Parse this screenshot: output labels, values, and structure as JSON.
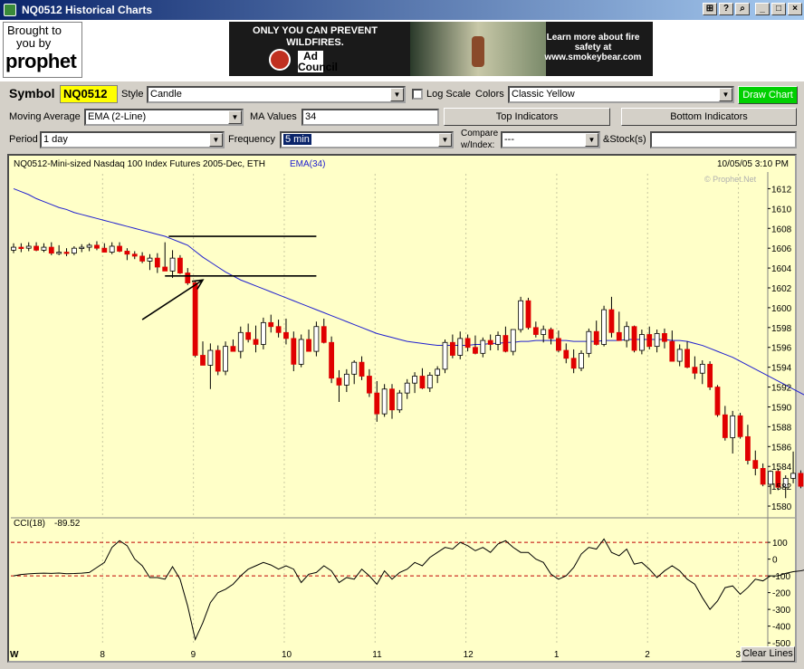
{
  "window": {
    "title": "NQ0512 Historical Charts",
    "controls": [
      "ok-icon",
      "help-icon",
      "search-icon",
      "minimize-icon",
      "maximize-icon",
      "close-icon"
    ]
  },
  "branding": {
    "brought_line1": "Brought to",
    "brought_line2": "you by",
    "logo_text": "prophet"
  },
  "ad": {
    "left_text": "ONLY YOU CAN PREVENT WILDFIRES.",
    "right_text": "Learn more about fire safety at www.smokeybear.com",
    "council": "Ad Council"
  },
  "toolbar": {
    "symbol_label": "Symbol",
    "symbol_value": "NQ0512",
    "style_label": "Style",
    "style_value": "Candle",
    "log_scale_label": "Log Scale",
    "colors_label": "Colors",
    "colors_value": "Classic Yellow",
    "draw_chart": "Draw Chart",
    "ma_label": "Moving Average",
    "ma_value": "EMA (2-Line)",
    "ma_values_label": "MA Values",
    "ma_values_value": "34",
    "top_indicators": "Top Indicators",
    "bottom_indicators": "Bottom Indicators",
    "period_label": "Period",
    "period_value": "1 day",
    "frequency_label": "Frequency",
    "frequency_value": "5 min",
    "compare_label_1": "Compare",
    "compare_label_2": "w/Index:",
    "compare_value": "---",
    "stocks_label": "&Stock(s)",
    "stocks_value": ""
  },
  "chart": {
    "heading": "NQ0512-Mini-sized Nasdaq 100 Index Futures 2005-Dec, ETH",
    "ema_label": "EMA(34)",
    "timestamp": "10/05/05  3:10 PM",
    "watermark": "© Prophet.Net",
    "clear_lines": "Clear Lines",
    "cci_label": "CCI(18)",
    "cci_value": "-89.52",
    "x_ticks": [
      "W",
      "8",
      "9",
      "10",
      "11",
      "12",
      "1",
      "2",
      "3"
    ],
    "colors": {
      "up": "#ffffff",
      "down": "#e00000",
      "ema": "#2020d0",
      "cci_ref": "#c00000",
      "bg": "#ffffc8"
    }
  },
  "chart_data": [
    {
      "type": "candlestick",
      "title": "NQ0512-Mini-sized Nasdaq 100 Index Futures 2005-Dec, ETH",
      "ylim": [
        1579,
        1613.5
      ],
      "y_ticks": [
        1580,
        1582,
        1584,
        1586,
        1588,
        1590,
        1592,
        1594,
        1596,
        1598,
        1600,
        1602,
        1604,
        1606,
        1608,
        1610,
        1612
      ],
      "x_tick_labels": [
        "W",
        "8",
        "9",
        "10",
        "11",
        "12",
        "1",
        "2",
        "3"
      ],
      "x_tick_bars": [
        0,
        12,
        24,
        36,
        48,
        60,
        72,
        84,
        96
      ],
      "candles": [
        [
          1605.8,
          1606.5,
          1605.5,
          1606.1
        ],
        [
          1606.1,
          1606.5,
          1605.6,
          1606.0
        ],
        [
          1606.0,
          1606.6,
          1605.7,
          1606.2
        ],
        [
          1606.2,
          1606.6,
          1605.7,
          1605.8
        ],
        [
          1605.8,
          1606.5,
          1605.6,
          1606.1
        ],
        [
          1606.1,
          1606.6,
          1605.3,
          1605.5
        ],
        [
          1605.5,
          1606.3,
          1605.3,
          1605.6
        ],
        [
          1605.6,
          1606.0,
          1605.2,
          1605.5
        ],
        [
          1605.5,
          1606.2,
          1605.3,
          1606.0
        ],
        [
          1606.0,
          1606.4,
          1605.6,
          1606.1
        ],
        [
          1606.1,
          1606.5,
          1605.7,
          1606.3
        ],
        [
          1606.3,
          1606.7,
          1605.8,
          1606.0
        ],
        [
          1606.0,
          1606.5,
          1605.6,
          1605.6
        ],
        [
          1605.6,
          1606.6,
          1605.4,
          1606.2
        ],
        [
          1606.2,
          1606.6,
          1605.6,
          1605.7
        ],
        [
          1605.7,
          1606.0,
          1604.8,
          1605.4
        ],
        [
          1605.4,
          1605.7,
          1604.9,
          1605.2
        ],
        [
          1605.2,
          1605.6,
          1604.5,
          1604.7
        ],
        [
          1604.7,
          1605.4,
          1603.8,
          1605.0
        ],
        [
          1605.0,
          1605.5,
          1603.5,
          1604.1
        ],
        [
          1604.1,
          1606.6,
          1603.8,
          1603.7
        ],
        [
          1603.7,
          1605.8,
          1603.0,
          1605.0
        ],
        [
          1605.0,
          1605.3,
          1603.4,
          1603.5
        ],
        [
          1603.5,
          1604.0,
          1602.3,
          1602.5
        ],
        [
          1602.5,
          1602.7,
          1595.0,
          1595.2
        ],
        [
          1595.2,
          1596.6,
          1594.2,
          1594.2
        ],
        [
          1594.2,
          1596.4,
          1591.8,
          1595.7
        ],
        [
          1595.7,
          1596.2,
          1593.2,
          1593.6
        ],
        [
          1593.6,
          1596.6,
          1593.2,
          1596.1
        ],
        [
          1596.1,
          1596.8,
          1595.6,
          1595.6
        ],
        [
          1595.6,
          1598.1,
          1594.9,
          1597.5
        ],
        [
          1597.5,
          1598.4,
          1596.5,
          1596.8
        ],
        [
          1596.8,
          1598.2,
          1595.5,
          1596.3
        ],
        [
          1596.3,
          1599.0,
          1595.8,
          1598.5
        ],
        [
          1598.5,
          1599.3,
          1597.5,
          1598.1
        ],
        [
          1598.1,
          1598.8,
          1597.0,
          1597.5
        ],
        [
          1597.5,
          1598.9,
          1596.3,
          1596.9
        ],
        [
          1596.9,
          1597.6,
          1593.6,
          1594.3
        ],
        [
          1594.3,
          1597.3,
          1594.0,
          1596.8
        ],
        [
          1596.8,
          1597.8,
          1595.6,
          1595.6
        ],
        [
          1595.6,
          1598.6,
          1595.1,
          1598.1
        ],
        [
          1598.1,
          1598.9,
          1596.4,
          1596.5
        ],
        [
          1596.5,
          1597.1,
          1592.4,
          1592.9
        ],
        [
          1592.9,
          1593.7,
          1590.5,
          1592.2
        ],
        [
          1592.2,
          1593.8,
          1591.5,
          1593.3
        ],
        [
          1593.3,
          1594.7,
          1592.3,
          1594.5
        ],
        [
          1594.5,
          1595.1,
          1592.7,
          1593.1
        ],
        [
          1593.1,
          1593.8,
          1591.0,
          1591.4
        ],
        [
          1591.4,
          1592.6,
          1588.5,
          1589.3
        ],
        [
          1589.3,
          1592.3,
          1589.0,
          1591.8
        ],
        [
          1591.8,
          1592.3,
          1588.8,
          1589.7
        ],
        [
          1589.7,
          1591.7,
          1589.4,
          1591.4
        ],
        [
          1591.4,
          1592.8,
          1590.8,
          1592.4
        ],
        [
          1592.4,
          1593.5,
          1591.4,
          1593.1
        ],
        [
          1593.1,
          1593.9,
          1591.8,
          1591.9
        ],
        [
          1591.9,
          1593.5,
          1591.5,
          1593.2
        ],
        [
          1593.2,
          1594.1,
          1592.4,
          1593.8
        ],
        [
          1593.8,
          1596.8,
          1593.4,
          1596.5
        ],
        [
          1596.5,
          1597.3,
          1594.9,
          1595.2
        ],
        [
          1595.2,
          1597.6,
          1594.8,
          1596.9
        ],
        [
          1596.9,
          1597.3,
          1595.6,
          1596.0
        ],
        [
          1596.0,
          1597.2,
          1595.3,
          1595.4
        ],
        [
          1595.4,
          1597.0,
          1595.0,
          1596.7
        ],
        [
          1596.7,
          1597.3,
          1595.7,
          1596.3
        ],
        [
          1596.3,
          1597.6,
          1595.7,
          1597.2
        ],
        [
          1597.2,
          1598.1,
          1595.5,
          1595.6
        ],
        [
          1595.6,
          1597.6,
          1595.2,
          1597.8
        ],
        [
          1597.8,
          1601.1,
          1597.5,
          1600.7
        ],
        [
          1600.7,
          1601.0,
          1597.8,
          1598.0
        ],
        [
          1598.0,
          1598.6,
          1597.0,
          1597.3
        ],
        [
          1597.3,
          1598.2,
          1596.5,
          1597.8
        ],
        [
          1597.8,
          1598.0,
          1596.3,
          1596.9
        ],
        [
          1596.9,
          1597.7,
          1595.5,
          1595.7
        ],
        [
          1595.7,
          1596.4,
          1594.4,
          1594.9
        ],
        [
          1594.9,
          1595.8,
          1593.4,
          1593.9
        ],
        [
          1593.9,
          1595.7,
          1593.6,
          1595.4
        ],
        [
          1595.4,
          1597.9,
          1595.0,
          1597.6
        ],
        [
          1597.6,
          1598.7,
          1596.2,
          1596.3
        ],
        [
          1596.3,
          1600.2,
          1596.1,
          1599.8
        ],
        [
          1599.8,
          1601.1,
          1597.0,
          1597.5
        ],
        [
          1597.5,
          1599.6,
          1596.9,
          1596.7
        ],
        [
          1596.7,
          1598.6,
          1596.0,
          1598.1
        ],
        [
          1598.1,
          1598.2,
          1595.5,
          1595.7
        ],
        [
          1595.7,
          1597.8,
          1595.3,
          1597.3
        ],
        [
          1597.3,
          1598.1,
          1595.8,
          1596.1
        ],
        [
          1596.1,
          1597.8,
          1595.5,
          1597.4
        ],
        [
          1597.4,
          1597.9,
          1595.9,
          1596.6
        ],
        [
          1596.6,
          1597.7,
          1595.5,
          1594.6
        ],
        [
          1594.6,
          1596.3,
          1594.1,
          1595.8
        ],
        [
          1595.8,
          1596.6,
          1593.9,
          1594.0
        ],
        [
          1594.0,
          1595.1,
          1592.8,
          1593.4
        ],
        [
          1593.4,
          1594.7,
          1592.3,
          1594.3
        ],
        [
          1594.3,
          1594.6,
          1591.7,
          1592.0
        ],
        [
          1592.0,
          1592.2,
          1589.0,
          1589.2
        ],
        [
          1589.2,
          1590.1,
          1586.6,
          1586.9
        ],
        [
          1586.9,
          1589.6,
          1585.3,
          1589.1
        ],
        [
          1589.1,
          1589.4,
          1586.8,
          1587.0
        ],
        [
          1587.0,
          1588.2,
          1584.2,
          1584.6
        ],
        [
          1584.6,
          1585.6,
          1583.1,
          1583.8
        ],
        [
          1583.8,
          1584.3,
          1582.0,
          1582.2
        ],
        [
          1582.2,
          1583.6,
          1581.2,
          1583.5
        ],
        [
          1583.5,
          1583.8,
          1581.6,
          1581.9
        ],
        [
          1581.9,
          1583.1,
          1580.8,
          1582.8
        ],
        [
          1582.8,
          1585.5,
          1582.3,
          1583.3
        ],
        [
          1583.3,
          1583.6,
          1581.8,
          1582.0
        ]
      ],
      "ema_34": [
        1612.0,
        1611.7,
        1611.4,
        1611.0,
        1610.7,
        1610.4,
        1610.1,
        1609.9,
        1609.6,
        1609.4,
        1609.2,
        1609.0,
        1608.8,
        1608.6,
        1608.4,
        1608.2,
        1608.0,
        1607.8,
        1607.6,
        1607.4,
        1607.2,
        1606.9,
        1606.6,
        1606.3,
        1605.7,
        1605.1,
        1604.6,
        1604.1,
        1603.6,
        1603.2,
        1602.8,
        1602.5,
        1602.2,
        1601.9,
        1601.6,
        1601.3,
        1601.0,
        1600.7,
        1600.4,
        1600.1,
        1599.8,
        1599.5,
        1599.2,
        1598.9,
        1598.6,
        1598.3,
        1598.0,
        1597.7,
        1597.4,
        1597.2,
        1597.0,
        1596.8,
        1596.6,
        1596.5,
        1596.4,
        1596.3,
        1596.2,
        1596.2,
        1596.2,
        1596.2,
        1596.2,
        1596.3,
        1596.3,
        1596.4,
        1596.4,
        1596.5,
        1596.5,
        1596.6,
        1596.6,
        1596.7,
        1596.7,
        1596.7,
        1596.7,
        1596.7,
        1596.6,
        1596.6,
        1596.6,
        1596.6,
        1596.7,
        1596.7,
        1596.7,
        1596.8,
        1596.8,
        1596.8,
        1596.8,
        1596.8,
        1596.8,
        1596.7,
        1596.7,
        1596.6,
        1596.4,
        1596.2,
        1595.9,
        1595.6,
        1595.3,
        1595.0,
        1594.6,
        1594.2,
        1593.8,
        1593.4,
        1593.0,
        1592.6,
        1592.2,
        1591.8,
        1591.4,
        1591.0,
        1590.6
      ],
      "annotations": [
        {
          "kind": "hline",
          "y": 1607.2,
          "x_from": 20.5,
          "x_to": 40
        },
        {
          "kind": "hline",
          "y": 1603.2,
          "x_from": 20.0,
          "x_to": 40
        },
        {
          "kind": "arrow",
          "from": [
            17,
            1598.8
          ],
          "to": [
            25,
            1602.8
          ]
        }
      ]
    },
    {
      "type": "line",
      "title": "CCI(18)",
      "ylim": [
        -510,
        160
      ],
      "y_ticks": [
        100,
        0,
        -100,
        -200,
        -300,
        -400,
        -500
      ],
      "reference_lines": [
        100,
        -100
      ],
      "values": [
        -100,
        -92,
        -88,
        -85,
        -84,
        -85,
        -83,
        -87,
        -86,
        -84,
        -80,
        -50,
        -20,
        70,
        110,
        80,
        0,
        -40,
        -110,
        -110,
        -120,
        -45,
        -120,
        -280,
        -480,
        -380,
        -260,
        -200,
        -180,
        -150,
        -100,
        -60,
        -40,
        -20,
        -35,
        -60,
        -40,
        -60,
        -140,
        -90,
        -80,
        -40,
        -70,
        -140,
        -110,
        -120,
        -60,
        -100,
        -150,
        -70,
        -120,
        -80,
        -60,
        -20,
        -40,
        10,
        40,
        70,
        60,
        100,
        80,
        50,
        70,
        40,
        90,
        110,
        70,
        40,
        40,
        0,
        -20,
        -90,
        -120,
        -100,
        -50,
        30,
        70,
        60,
        120,
        40,
        20,
        60,
        -30,
        -20,
        -60,
        -110,
        -70,
        -40,
        -70,
        -120,
        -150,
        -230,
        -300,
        -250,
        -170,
        -160,
        -210,
        -170,
        -120,
        -130,
        -100,
        -100,
        -85,
        -75,
        -70,
        -60,
        -90
      ]
    }
  ]
}
